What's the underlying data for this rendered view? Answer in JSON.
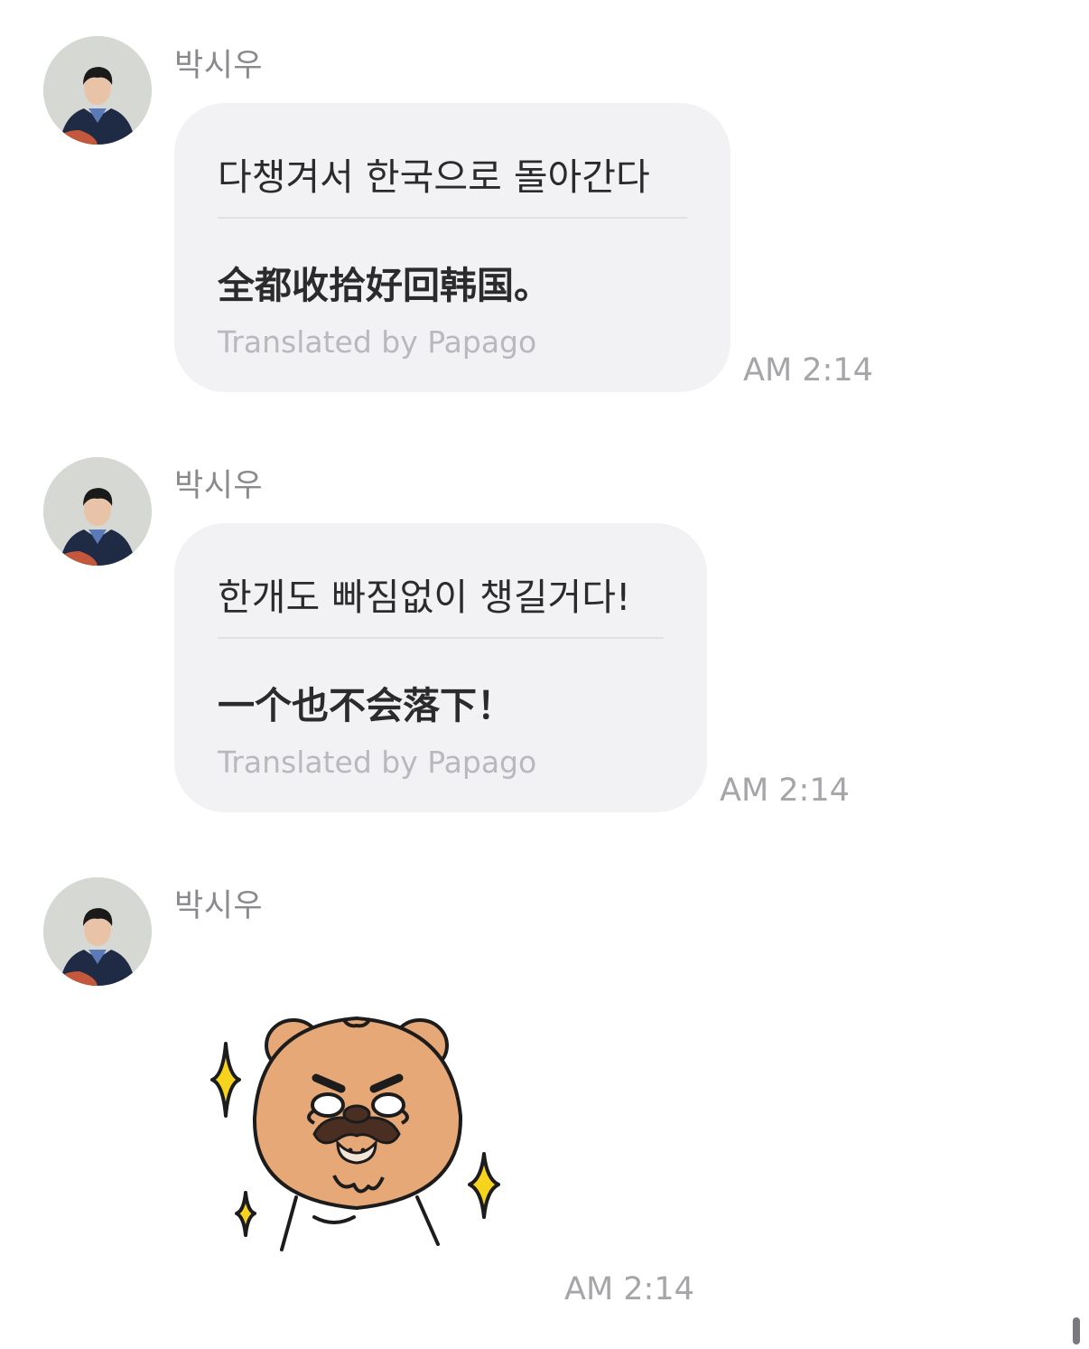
{
  "messages": [
    {
      "sender": "박시우",
      "original": "다챙겨서 한국으로 돌아간다",
      "translated": "全都收拾好回韩国。",
      "credit": "Translated by Papago",
      "time": "AM 2:14"
    },
    {
      "sender": "박시우",
      "original": "한개도 빠짐없이 챙길거다!",
      "translated": "一个也不会落下！",
      "credit": "Translated by Papago",
      "time": "AM 2:14"
    },
    {
      "sender": "박시우",
      "sticker": "bear-mustache-sticker",
      "time": "AM 2:14"
    }
  ],
  "colors": {
    "bubble": "#f2f2f4",
    "sender_text": "#8a8a8e",
    "time_text": "#a5a5aa",
    "credit_text": "#b9b9bd",
    "message_text": "#2b2b2d"
  }
}
